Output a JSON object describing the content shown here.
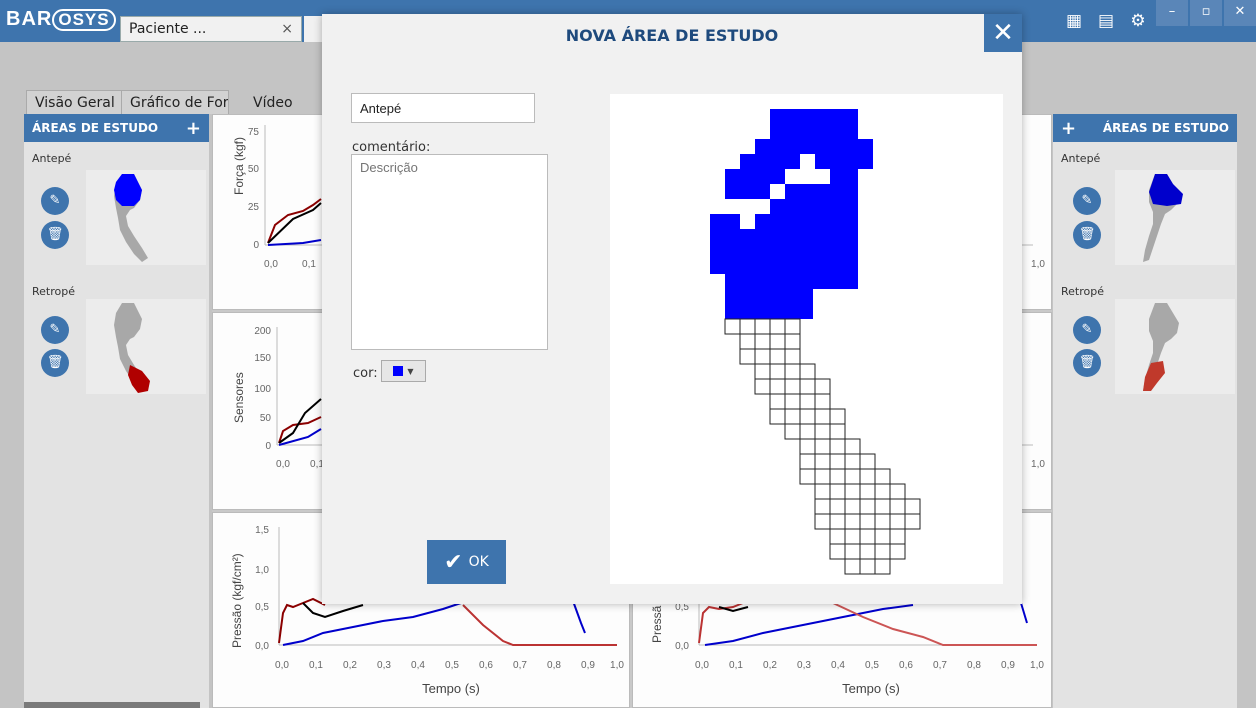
{
  "app": {
    "logo": "BAROSYS"
  },
  "document_tab": {
    "label": "Paciente ...",
    "close": "×"
  },
  "main_tabs": [
    {
      "label": "Visão Geral"
    },
    {
      "label": "Gráfico de Forç"
    },
    {
      "label": "Vídeo"
    }
  ],
  "left_panel": {
    "title": "ÁREAS DE ESTUDO",
    "add": "+",
    "areas": [
      {
        "name": "Antepé",
        "color": "#0000ff"
      },
      {
        "name": "Retropé",
        "color": "#b00000"
      }
    ]
  },
  "right_panel": {
    "title": "ÁREAS DE ESTUDO",
    "add": "+",
    "areas": [
      {
        "name": "Antepé",
        "color": "#0000ff"
      },
      {
        "name": "Retropé",
        "color": "#b00000"
      }
    ]
  },
  "charts": {
    "force": {
      "ylabel": "Força (kgf)",
      "yticks": [
        "75",
        "50",
        "25",
        "0"
      ],
      "xticks": [
        "0,0",
        "0,1"
      ]
    },
    "sensors": {
      "ylabel": "Sensores",
      "yticks": [
        "200",
        "150",
        "100",
        "50",
        "0"
      ],
      "xticks": [
        "0,0",
        "0,1"
      ]
    },
    "pressure": {
      "ylabel": "Pressão (kgf/cm²)",
      "yticks": [
        "1,5",
        "1,0",
        "0,5",
        "0,0"
      ],
      "xticks": [
        "0,0",
        "0,1",
        "0,2",
        "0,3",
        "0,4",
        "0,5",
        "0,6",
        "0,7",
        "0,8",
        "0,9",
        "1,0"
      ],
      "xlabel": "Tempo (s)"
    },
    "right_partial_xtick": "1,0",
    "right_pressure": {
      "ylabel": "Pressã",
      "yticks": [
        "0,5",
        "0,0"
      ],
      "xticks": [
        "0,0",
        "0,1",
        "0,2",
        "0,3",
        "0,4",
        "0,5",
        "0,6",
        "0,7",
        "0,8",
        "0,9",
        "1,0"
      ],
      "xlabel": "Tempo (s)"
    }
  },
  "modal": {
    "title": "NOVA ÁREA DE ESTUDO",
    "close": "✕",
    "name_value": "Antepé",
    "comment_label": "comentário:",
    "comment_placeholder": "Descrição",
    "color_label": "cor:",
    "color_value": "#0000ff",
    "ok_label": "OK"
  }
}
